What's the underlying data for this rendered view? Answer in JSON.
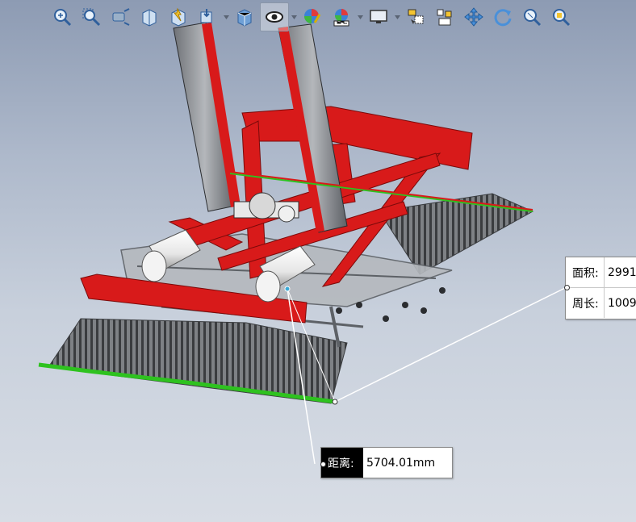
{
  "toolbar": {
    "items": [
      {
        "name": "zoom-to-fit",
        "has_dropdown": false
      },
      {
        "name": "zoom-to-area",
        "has_dropdown": false
      },
      {
        "name": "previous-view",
        "has_dropdown": false
      },
      {
        "name": "section-view",
        "has_dropdown": false
      },
      {
        "name": "dynamic-annotation-views",
        "has_dropdown": false
      },
      {
        "name": "view-orientation",
        "has_dropdown": true
      },
      {
        "name": "display-style",
        "has_dropdown": false
      },
      {
        "name": "hide-show-items",
        "has_dropdown": true,
        "selected": true
      },
      {
        "name": "edit-appearance",
        "has_dropdown": false
      },
      {
        "name": "apply-scene",
        "has_dropdown": true
      },
      {
        "name": "view-settings",
        "has_dropdown": true
      },
      {
        "name": "select",
        "has_dropdown": false
      },
      {
        "name": "select-other",
        "has_dropdown": false
      },
      {
        "name": "pan",
        "has_dropdown": false
      },
      {
        "name": "rotate",
        "has_dropdown": false
      },
      {
        "name": "zoom-in-out",
        "has_dropdown": false
      },
      {
        "name": "zoom-to-selection",
        "has_dropdown": false
      }
    ]
  },
  "measure": {
    "area_label": "面积:",
    "area_value": "2991",
    "perimeter_label": "周长:",
    "perimeter_value": "1009",
    "distance_label": "距离:",
    "distance_value": "5704.01mm"
  },
  "colors": {
    "frame_red": "#d81a1a",
    "rail_green": "#2ec21f",
    "measure_line": "#ffffff",
    "callout_label_bg": "#000000"
  }
}
